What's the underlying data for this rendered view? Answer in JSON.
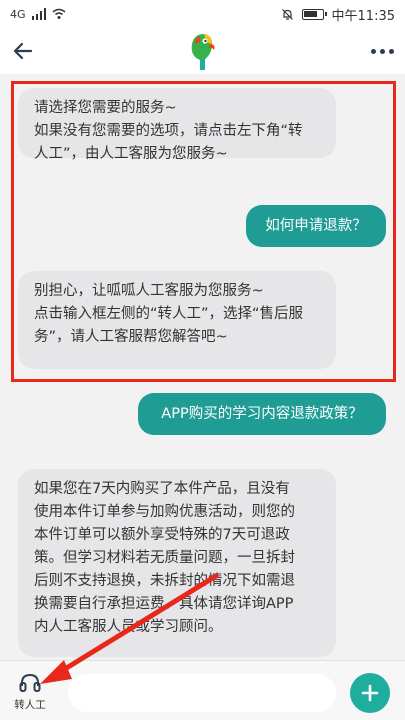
{
  "status_bar": {
    "carrier": "4G",
    "time": "中午11:35",
    "icons": [
      "signal-icon",
      "wifi-icon",
      "mute-bell-icon",
      "battery-icon"
    ]
  },
  "header": {
    "back_icon": "back-arrow-icon",
    "logo_icon": "parrot-logo-icon",
    "more_icon": "more-dots-icon"
  },
  "messages": [
    {
      "side": "bot",
      "lines": [
        "请选择您需要的服务~",
        "如果没有您需要的选项，请点击左下角“转",
        "人工”，由人工客服为您服务~"
      ]
    },
    {
      "side": "user",
      "lines": [
        "如何申请退款？"
      ]
    },
    {
      "side": "bot",
      "lines": [
        "别担心，让呱呱人工客服为您服务~",
        "点击输入框左侧的“转人工”，选择“售后服",
        "务”，请人工客服帮您解答吧~"
      ]
    },
    {
      "side": "user",
      "lines": [
        "APP购买的学习内容退款政策？"
      ]
    },
    {
      "side": "bot",
      "lines": [
        "如果您在7天内购买了本件产品，且没有",
        "使用本件订单参与加购优惠活动，则您的",
        "本件订单可以额外享受特殊的7天可退政",
        "策。但学习材料若无质量问题，一旦拆封",
        "后则不支持退换，未拆封的情况下如需退",
        "换需要自行承担运费。具体请您详询APP",
        "内人工客服人员或学习顾问。"
      ]
    }
  ],
  "bottom_bar": {
    "human_label": "转人工",
    "input_placeholder": "",
    "add_icon": "plus-icon"
  },
  "colors": {
    "accent": "#1f9c93",
    "bot_bubble": "#e6e6e8",
    "annotation_red": "#e8281b"
  }
}
